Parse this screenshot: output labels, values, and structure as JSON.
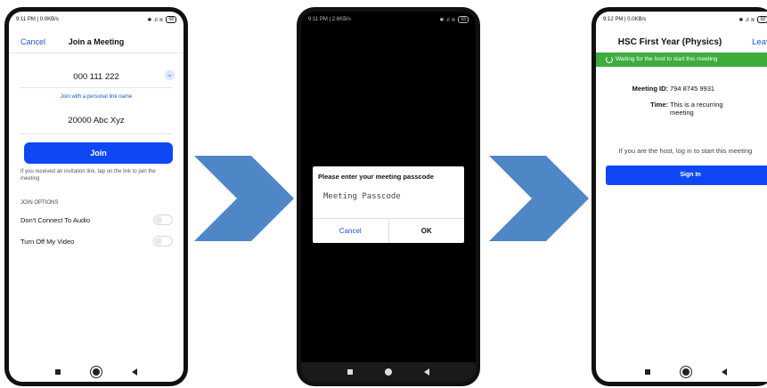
{
  "phone1": {
    "status": {
      "time": "9:11 PM | 0.0KB/s",
      "icons": "✱ .ıl ≋",
      "battery": "68"
    },
    "header": {
      "cancel": "Cancel",
      "title": "Join a Meeting"
    },
    "meeting_id": "000 111 222",
    "personal_link": "Join with a personal link name",
    "display_name": "20000 Abc Xyz",
    "join_button": "Join",
    "invitation_hint": "If you received an invitation link, tap on the link to join the meeting",
    "join_options_header": "JOIN OPTIONS",
    "options": [
      {
        "label": "Don't Connect To Audio"
      },
      {
        "label": "Turn Off My Video"
      }
    ]
  },
  "phone2": {
    "status": {
      "time": "9:11 PM | 2.6KB/s",
      "icons": "✱ .ıl ≋",
      "battery": "68"
    },
    "dialog": {
      "title": "Please enter your meeting passcode",
      "placeholder": "Meeting Passcode",
      "cancel": "Cancel",
      "ok": "OK"
    }
  },
  "phone3": {
    "status": {
      "time": "9:12 PM | 0.0KB/s",
      "icons": "✱ .ıl ≋",
      "battery": "68"
    },
    "header": {
      "title": "HSC First Year (Physics)",
      "leave": "Leave"
    },
    "waiting": "Waiting for the host to start this meeting",
    "meeting_id_label": "Meeting ID:",
    "meeting_id_value": "794 8745 9931",
    "time_label": "Time:",
    "time_value": "This is a recurring meeting",
    "host_message": "If you are the host, log in to start this meeting",
    "sign_in": "Sign In"
  },
  "colors": {
    "accent": "#0e48f5",
    "waiting_bar": "#3dad3d",
    "arrow": "#4f86c6"
  }
}
